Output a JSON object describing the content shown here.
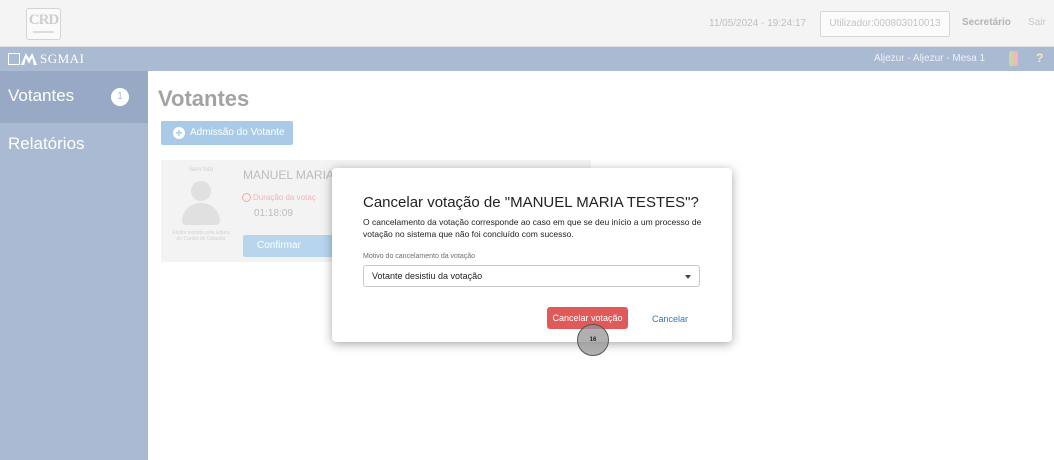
{
  "topbar": {
    "logo_text": "CRD",
    "datetime": "11/05/2024 - 19:24:17",
    "user": "Utilizador:000803010013",
    "role": "Secretário",
    "logout": "Sair"
  },
  "navbar": {
    "brand": "SGMAI",
    "location": "Aljezur - Aljezur - Mesa 1",
    "help": "?"
  },
  "sidebar": {
    "items": [
      {
        "label": "Votantes",
        "badge": "1",
        "active": true
      },
      {
        "label": "Relatórios"
      }
    ]
  },
  "main": {
    "title": "Votantes",
    "admit_button": "Admissão do Votante",
    "admit_icon": "+",
    "card": {
      "photo_label": "Sem foto",
      "photo_note": "Eleitor inscrito pela leitura do Cartão de Cidadão",
      "name": "MANUEL MARIA T",
      "duration_label": "Duração da votaç",
      "elapsed": "01:18:09",
      "confirm_button": "Confirmar votação"
    }
  },
  "modal": {
    "title": "Cancelar votação de \"MANUEL MARIA TESTES\"?",
    "description": "O cancelamento da votação corresponde ao caso em que se deu início a um processo de votação no sistema que não foi concluído com sucesso.",
    "reason_label": "Motivo do cancelamento da votação",
    "reason_value": "Votante desistiu da votação",
    "confirm_button": "Cancelar votação",
    "cancel_button": "Cancelar"
  },
  "click_marker": "16",
  "colors": {
    "nav_blue": "#a9bad2",
    "primary_button": "#a9cbe8",
    "danger_button": "#e15a5a",
    "link": "#2a78c2"
  }
}
